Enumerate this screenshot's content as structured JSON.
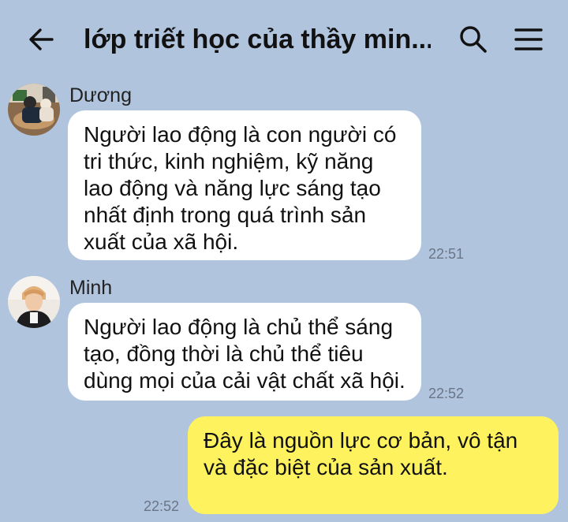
{
  "header": {
    "title": "lớp triết học của thầy min...",
    "back_icon": "arrow-left-icon",
    "search_icon": "search-icon",
    "menu_icon": "menu-icon"
  },
  "messages": [
    {
      "sender": "Dương",
      "text": "Người lao động là con người có tri thức, kinh nghiệm, kỹ năng lao động và năng lực sáng tạo nhất định trong quá trình sản xuất của xã hội.",
      "time": "22:51"
    },
    {
      "sender": "Minh",
      "text": "Người lao động là chủ thể sáng tạo, đồng thời là chủ thể tiêu dùng mọi của cải vật chất xã hội.",
      "time": "22:52"
    },
    {
      "text": "Đây là nguồn lực cơ bản, vô tận và đặc biệt của sản xuất.",
      "time": "22:52"
    }
  ],
  "colors": {
    "background": "#b0c4de",
    "incoming_bubble": "#ffffff",
    "outgoing_bubble": "#fef35f"
  }
}
